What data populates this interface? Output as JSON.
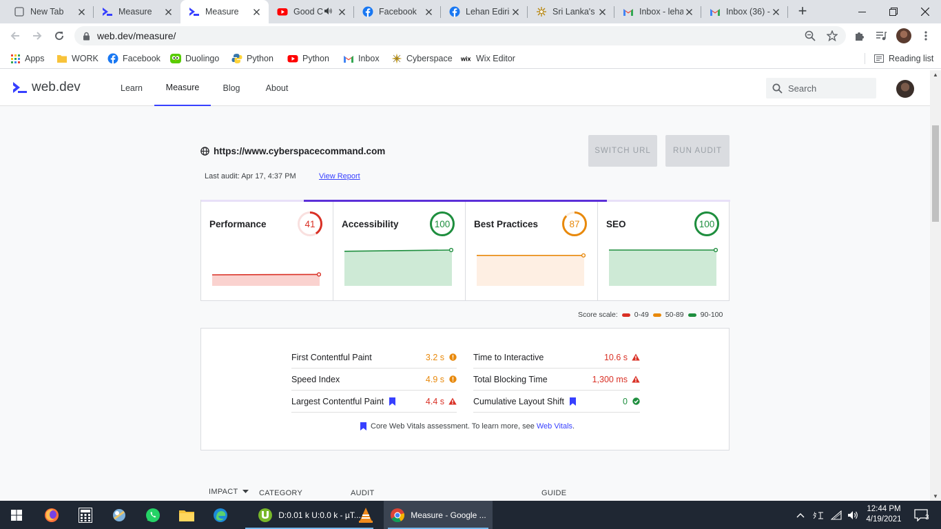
{
  "tabs": [
    {
      "title": "New Tab",
      "icon": "new-tab-icon",
      "active": false
    },
    {
      "title": "Measure",
      "icon": "webdev-icon",
      "active": false
    },
    {
      "title": "Measure",
      "icon": "webdev-icon",
      "active": true
    },
    {
      "title": "Good C",
      "icon": "youtube-icon",
      "active": false,
      "audio": true
    },
    {
      "title": "Facebook",
      "icon": "facebook-icon",
      "active": false
    },
    {
      "title": "Lehan Ediris",
      "icon": "facebook-icon",
      "active": false
    },
    {
      "title": "Sri Lanka's",
      "icon": "sri-lanka-icon",
      "active": false
    },
    {
      "title": "Inbox - leha",
      "icon": "gmail-icon",
      "active": false
    },
    {
      "title": "Inbox (36) -",
      "icon": "gmail-icon",
      "active": false
    }
  ],
  "omnibox": {
    "url": "web.dev/measure/"
  },
  "bookmarks": [
    {
      "label": "Apps",
      "icon": "apps-grid-icon"
    },
    {
      "label": "WORK",
      "icon": "folder-icon"
    },
    {
      "label": "Facebook",
      "icon": "facebook-icon"
    },
    {
      "label": "Duolingo",
      "icon": "duolingo-icon"
    },
    {
      "label": "Python",
      "icon": "python-icon"
    },
    {
      "label": "Python",
      "icon": "youtube-icon"
    },
    {
      "label": "Inbox",
      "icon": "gmail-icon"
    },
    {
      "label": "Cyberspace",
      "icon": "cyberspace-icon"
    },
    {
      "label": "Wix Editor",
      "icon": "wix-icon"
    }
  ],
  "reading_list": "Reading list",
  "site": {
    "logo": "web.dev",
    "nav": [
      "Learn",
      "Measure",
      "Blog",
      "About"
    ],
    "active_nav": "Measure",
    "search_placeholder": "Search"
  },
  "audit": {
    "url": "https://www.cyberspacecommand.com",
    "last_audit": "Last audit: Apr 17, 4:37 PM",
    "view_report": "View Report",
    "switch_url": "SWITCH URL",
    "run_audit": "RUN AUDIT"
  },
  "scores": [
    {
      "name": "Performance",
      "score": 41,
      "color": "#d93025",
      "fill": "#fad2cf",
      "history": [
        40,
        41
      ]
    },
    {
      "name": "Accessibility",
      "score": 100,
      "color": "#1e8e3e",
      "fill": "#ceead6",
      "history": [
        97,
        100
      ]
    },
    {
      "name": "Best Practices",
      "score": 87,
      "color": "#e8890c",
      "fill": "#feefe3",
      "history": [
        87,
        87
      ]
    },
    {
      "name": "SEO",
      "score": 100,
      "color": "#1e8e3e",
      "fill": "#ceead6",
      "history": [
        100,
        100
      ]
    }
  ],
  "scale": {
    "label": "Score scale:",
    "ranges": [
      {
        "label": "0-49",
        "color": "#d93025"
      },
      {
        "label": "50-89",
        "color": "#e8890c"
      },
      {
        "label": "90-100",
        "color": "#1e8e3e"
      }
    ]
  },
  "metrics": [
    {
      "name": "First Contentful Paint",
      "value": "3.2 s",
      "status": "average",
      "cwv": false
    },
    {
      "name": "Time to Interactive",
      "value": "10.6 s",
      "status": "fail",
      "cwv": false
    },
    {
      "name": "Speed Index",
      "value": "4.9 s",
      "status": "average",
      "cwv": false
    },
    {
      "name": "Total Blocking Time",
      "value": "1,300 ms",
      "status": "fail",
      "cwv": false
    },
    {
      "name": "Largest Contentful Paint",
      "value": "4.4 s",
      "status": "fail",
      "cwv": true
    },
    {
      "name": "Cumulative Layout Shift",
      "value": "0",
      "status": "pass",
      "cwv": true
    }
  ],
  "cwv_note": {
    "text": "Core Web Vitals assessment. To learn more, see",
    "link": "Web Vitals",
    "end": "."
  },
  "table_headers": [
    "IMPACT",
    "CATEGORY",
    "AUDIT",
    "GUIDE"
  ],
  "taskbar": {
    "utorrent_label": "D:0.01 k U:0.0 k - µT...",
    "chrome_label": "Measure - Google ...",
    "time": "12:44 PM",
    "date": "4/19/2021",
    "notifications": "3"
  }
}
